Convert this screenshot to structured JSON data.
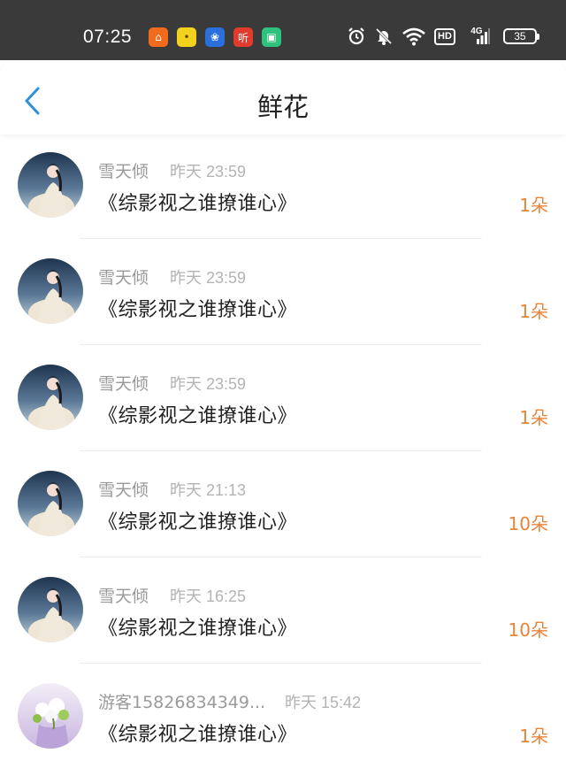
{
  "status_bar": {
    "time": "07:25",
    "apps": [
      {
        "icon": "taobao-app-icon",
        "color": "#f26b1d",
        "glyph": "⌂"
      },
      {
        "icon": "chat-app-icon",
        "color": "#f2d21d",
        "glyph": "•"
      },
      {
        "icon": "baidu-app-icon",
        "color": "#2a6fdb",
        "glyph": "❀"
      },
      {
        "icon": "ting-app-icon",
        "color": "#e23b2e",
        "glyph": "听"
      },
      {
        "icon": "shop-app-icon",
        "color": "#2ec27e",
        "glyph": "▣"
      }
    ],
    "hd_label": "HD",
    "network_label": "4G",
    "battery": "35"
  },
  "header": {
    "title": "鲜花"
  },
  "records": [
    {
      "name": "雪天倾",
      "day": "昨天",
      "time": "23:59",
      "book": "《综影视之谁撩谁心》",
      "count": "1朵",
      "avatar": "hanfu-girl"
    },
    {
      "name": "雪天倾",
      "day": "昨天",
      "time": "23:59",
      "book": "《综影视之谁撩谁心》",
      "count": "1朵",
      "avatar": "hanfu-girl"
    },
    {
      "name": "雪天倾",
      "day": "昨天",
      "time": "23:59",
      "book": "《综影视之谁撩谁心》",
      "count": "1朵",
      "avatar": "hanfu-girl"
    },
    {
      "name": "雪天倾",
      "day": "昨天",
      "time": "21:13",
      "book": "《综影视之谁撩谁心》",
      "count": "10朵",
      "avatar": "hanfu-girl"
    },
    {
      "name": "雪天倾",
      "day": "昨天",
      "time": "16:25",
      "book": "《综影视之谁撩谁心》",
      "count": "10朵",
      "avatar": "hanfu-girl"
    },
    {
      "name": "游客15826834349...",
      "day": "昨天",
      "time": "15:42",
      "book": "《综影视之谁撩谁心》",
      "count": "1朵",
      "avatar": "flower-vase"
    }
  ],
  "colors": {
    "accent_blue": "#2d8fe0",
    "count_orange": "#e8833a",
    "status_bg": "#3a3a3a"
  }
}
